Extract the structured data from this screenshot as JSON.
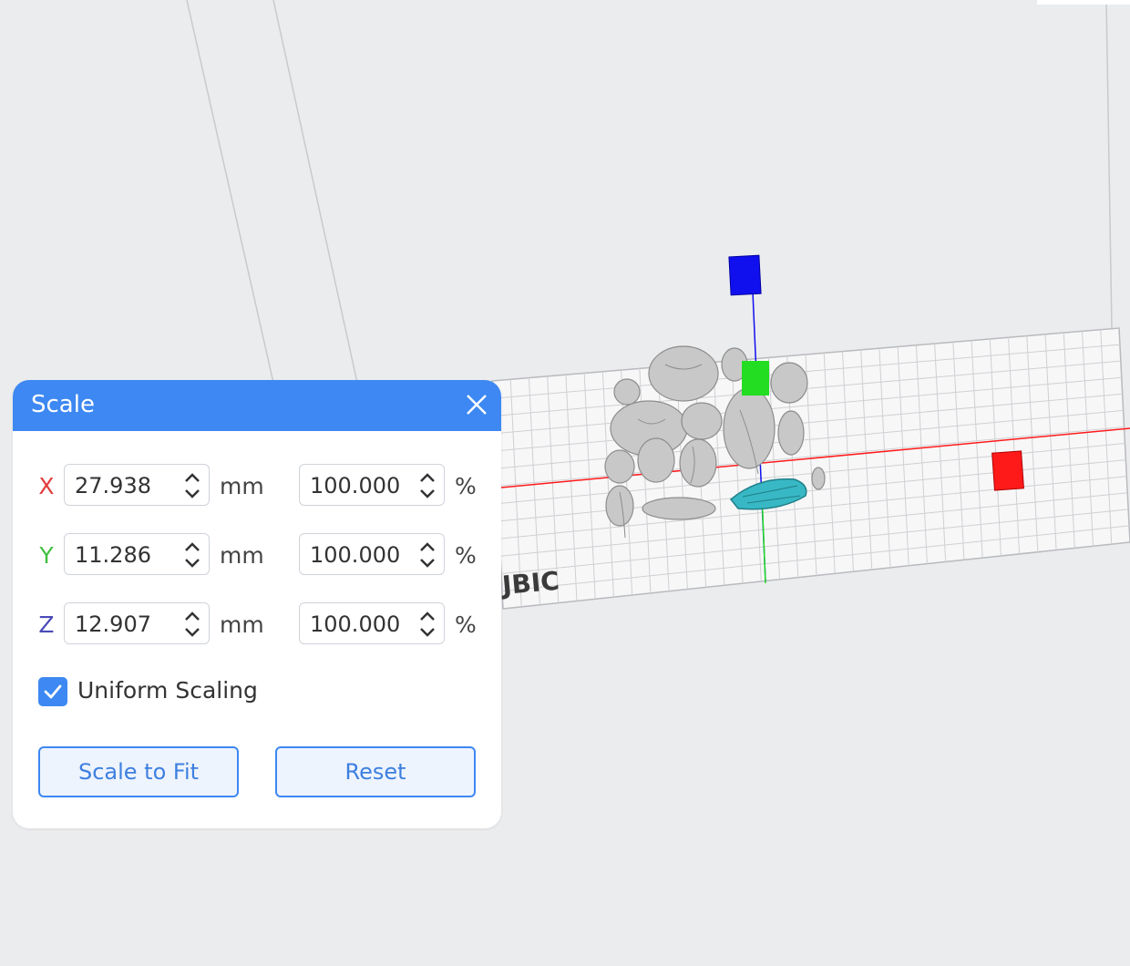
{
  "scale_panel": {
    "title": "Scale",
    "rows": [
      {
        "axis": "X",
        "axis_color": "#e03c3c",
        "mm": "27.938",
        "mm_unit": "mm",
        "percent": "100.000",
        "percent_unit": "%"
      },
      {
        "axis": "Y",
        "axis_color": "#3fbf3f",
        "mm": "11.286",
        "mm_unit": "mm",
        "percent": "100.000",
        "percent_unit": "%"
      },
      {
        "axis": "Z",
        "axis_color": "#4a4ab8",
        "mm": "12.907",
        "mm_unit": "mm",
        "percent": "100.000",
        "percent_unit": "%"
      }
    ],
    "uniform_scaling": {
      "label": "Uniform Scaling",
      "checked": true
    },
    "scale_to_fit_label": "Scale to Fit",
    "reset_label": "Reset"
  },
  "viewport": {
    "bed_logo_text": "JBIC",
    "colors": {
      "x_axis": "#ff1a1a",
      "y_axis": "#22dd22",
      "z_axis": "#1010ee",
      "selected_model": "#38b8c4",
      "model": "#c8c8c8"
    }
  },
  "colors": {
    "accent": "#3d88f2",
    "background": "#ebecee"
  }
}
